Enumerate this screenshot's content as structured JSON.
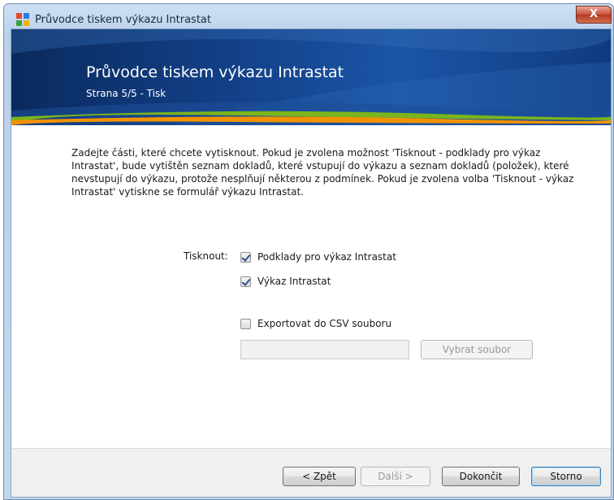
{
  "window": {
    "title": "Průvodce tiskem výkazu Intrastat",
    "close_label": "X"
  },
  "banner": {
    "title": "Průvodce tiskem výkazu Intrastat",
    "subtitle": "Strana 5/5 - Tisk"
  },
  "content": {
    "description": "Zadejte části, které chcete vytisknout. Pokud je zvolena možnost 'Tisknout - podklady pro výkaz Intrastat', bude vytištěn seznam dokladů, které vstupují do výkazu a seznam dokladů (položek), které nevstupují do výkazu, protože nesplňují některou z podmínek. Pokud je zvolena volba 'Tisknout - výkaz Intrastat' vytiskne se formulář výkazu Intrastat.",
    "print_label": "Tisknout:",
    "options": [
      {
        "label": "Podklady pro výkaz Intrastat",
        "checked": true
      },
      {
        "label": "Výkaz Intrastat",
        "checked": true
      },
      {
        "label": "Exportovat do CSV souboru",
        "checked": false
      }
    ],
    "file_input_value": "",
    "select_file_label": "Vybrat soubor"
  },
  "footer": {
    "back_label": "< Zpět",
    "next_label": "Další >",
    "finish_label": "Dokončit",
    "cancel_label": "Storno"
  },
  "colors": {
    "banner_dark": "#0a2a5e",
    "banner_light": "#1b55a6",
    "accent_green": "#7ab51d",
    "accent_orange": "#f39200"
  }
}
